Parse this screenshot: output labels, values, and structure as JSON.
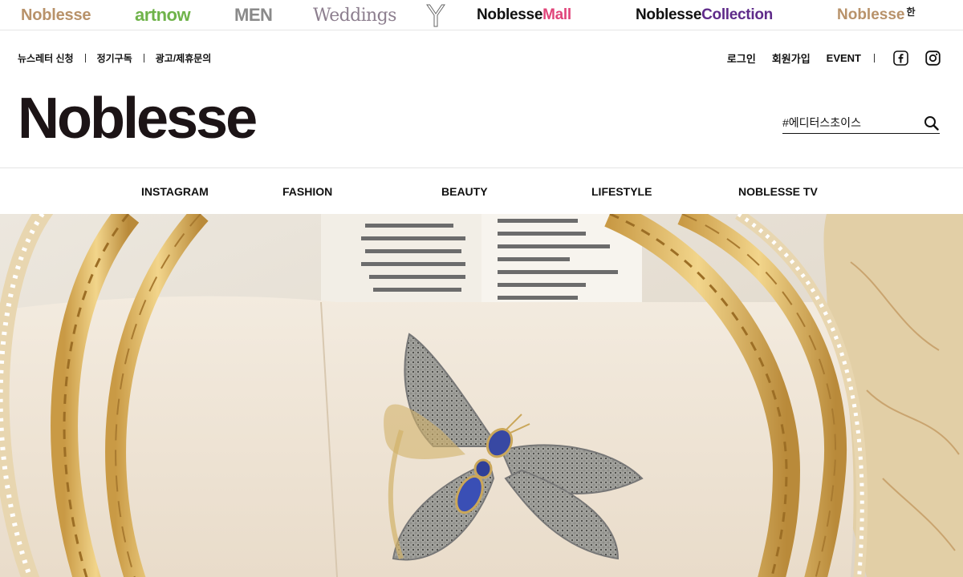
{
  "brands": {
    "noblesse": "Noblesse",
    "artnow": "artnow",
    "men": "MEN",
    "weddings": "Weddings",
    "y": "Y",
    "mall_a": "Noblesse",
    "mall_b": "Mall",
    "collection_a": "Noblesse",
    "collection_b": "Collection",
    "noblesse_han_a": "Noblesse",
    "noblesse_han_b": "한"
  },
  "util_left": {
    "newsletter": "뉴스레터 신청",
    "subscribe": "정기구독",
    "ad_inquiry": "광고/제휴문의"
  },
  "util_right": {
    "login": "로그인",
    "signup": "회원가입",
    "event": "EVENT"
  },
  "logo_text": "Noblesse",
  "search": {
    "value": "#에디터스초이스"
  },
  "nav": {
    "items": [
      "INSTAGRAM",
      "FASHION",
      "BEAUTY",
      "LIFESTYLE",
      "NOBLESSE TV"
    ]
  },
  "colors": {
    "brand_gold": "#b8926a",
    "artnow_green": "#6fb34a",
    "mall_pink": "#e0457a",
    "collection_purple": "#5f2b8a",
    "logo_dark": "#1c1416"
  },
  "icons": {
    "facebook": "facebook-icon",
    "instagram": "instagram-icon",
    "search": "search-icon"
  }
}
